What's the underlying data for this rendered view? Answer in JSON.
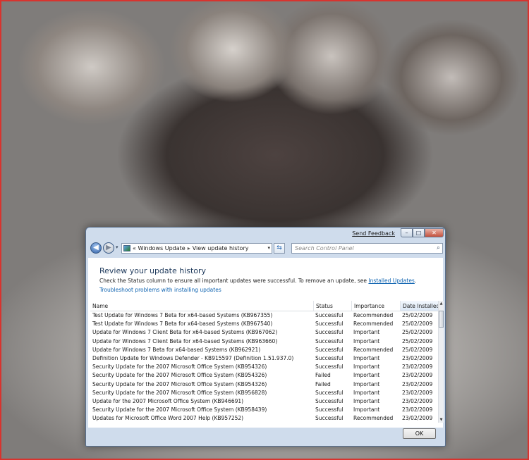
{
  "window": {
    "send_feedback": "Send Feedback",
    "controls": {
      "minimize": "–",
      "maximize": "□",
      "close": "✕"
    }
  },
  "nav": {
    "back_glyph": "◀",
    "forward_glyph": "▶",
    "recent_glyph": "▾",
    "breadcrumb": [
      "«",
      "Windows Update",
      "View update history"
    ],
    "dropdown_glyph": "▾",
    "refresh_glyph": "⇆",
    "search_placeholder": "Search Control Panel",
    "search_glyph": "⌕"
  },
  "page": {
    "heading": "Review your update history",
    "instructions": "Check the Status column to ensure all important updates were successful. To remove an update, see ",
    "instructions_link": "Installed Updates",
    "instructions_end": ".",
    "troubleshoot_link": "Troubleshoot problems with installing updates"
  },
  "table": {
    "columns": [
      "Name",
      "Status",
      "Importance",
      "Date Installed"
    ],
    "rows": [
      [
        "Test Update for Windows 7 Beta for x64-based Systems (KB967355)",
        "Successful",
        "Recommended",
        "25/02/2009"
      ],
      [
        "Test Update for Windows 7 Beta for x64-based Systems (KB967540)",
        "Successful",
        "Recommended",
        "25/02/2009"
      ],
      [
        "Update for Windows 7 Client Beta for x64-based Systems (KB967062)",
        "Successful",
        "Important",
        "25/02/2009"
      ],
      [
        "Update for Windows 7 Client Beta for x64-based Systems (KB963660)",
        "Successful",
        "Important",
        "25/02/2009"
      ],
      [
        "Update for Windows 7 Beta for x64-based Systems (KB962921)",
        "Successful",
        "Recommended",
        "25/02/2009"
      ],
      [
        "Definition Update for Windows Defender - KB915597 (Definition 1.51.937.0)",
        "Successful",
        "Important",
        "23/02/2009"
      ],
      [
        "Security Update for the 2007 Microsoft Office System (KB954326)",
        "Successful",
        "Important",
        "23/02/2009"
      ],
      [
        "Security Update for the 2007 Microsoft Office System (KB954326)",
        "Failed",
        "Important",
        "23/02/2009"
      ],
      [
        "Security Update for the 2007 Microsoft Office System (KB954326)",
        "Failed",
        "Important",
        "23/02/2009"
      ],
      [
        "Security Update for the 2007 Microsoft Office System (KB956828)",
        "Successful",
        "Important",
        "23/02/2009"
      ],
      [
        "Update for the 2007 Microsoft Office System (KB946691)",
        "Successful",
        "Important",
        "23/02/2009"
      ],
      [
        "Security Update for the 2007 Microsoft Office System (KB958439)",
        "Successful",
        "Important",
        "23/02/2009"
      ],
      [
        "Updates for Microsoft Office Word 2007 Help (KB957252)",
        "Successful",
        "Recommended",
        "23/02/2009"
      ]
    ],
    "scroll_up": "▲",
    "scroll_down": "▼"
  },
  "footer": {
    "ok_label": "OK"
  },
  "colors": {
    "accent": "#1e395b",
    "link": "#0c62b0",
    "frame": "#d8332e"
  }
}
